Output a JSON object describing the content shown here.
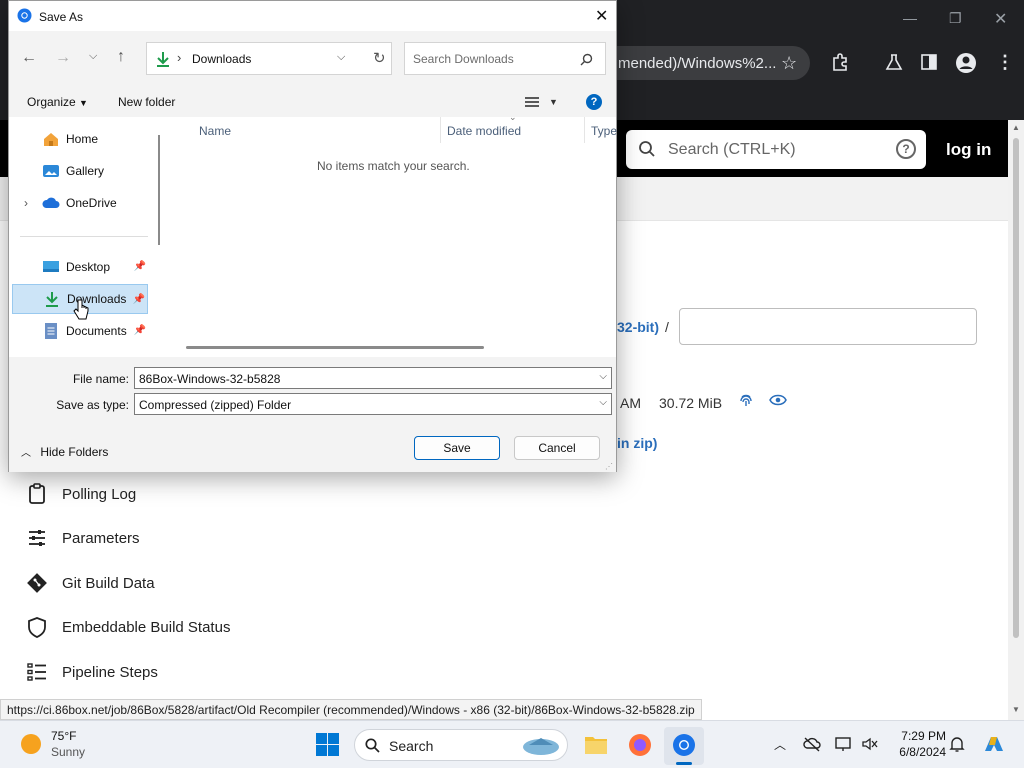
{
  "browser": {
    "address_fragment": "mended)/Windows%2...",
    "window_controls": [
      "minimize",
      "restore",
      "close"
    ]
  },
  "page": {
    "search_placeholder": "Search (CTRL+K)",
    "login_label": "log in",
    "frag_32bit": "32-bit)",
    "frag_slash": "/",
    "frag_am": "AM",
    "frag_size": "30.72 MiB",
    "frag_inzip": "in zip)",
    "sidebar": [
      {
        "label": "Polling Log",
        "icon": "clipboard-icon"
      },
      {
        "label": "Parameters",
        "icon": "sliders-icon"
      },
      {
        "label": "Git Build Data",
        "icon": "git-icon"
      },
      {
        "label": "Embeddable Build Status",
        "icon": "shield-icon"
      },
      {
        "label": "Pipeline Steps",
        "icon": "list-icon"
      }
    ],
    "status_url": "https://ci.86box.net/job/86Box/5828/artifact/Old Recompiler (recommended)/Windows - x86 (32-bit)/86Box-Windows-32-b5828.zip"
  },
  "dialog": {
    "title": "Save As",
    "path_label": "Downloads",
    "search_placeholder": "Search Downloads",
    "organize_label": "Organize",
    "new_folder_label": "New folder",
    "nav_items": [
      {
        "label": "Home",
        "icon": "home-icon",
        "pinned": false
      },
      {
        "label": "Gallery",
        "icon": "gallery-icon",
        "pinned": false
      },
      {
        "label": "OneDrive",
        "icon": "cloud-icon",
        "pinned": false
      },
      {
        "label": "Desktop",
        "icon": "desktop-icon",
        "pinned": true
      },
      {
        "label": "Downloads",
        "icon": "download-icon",
        "pinned": true,
        "selected": true
      },
      {
        "label": "Documents",
        "icon": "document-icon",
        "pinned": true
      }
    ],
    "columns": [
      "Name",
      "Date modified",
      "Type"
    ],
    "empty_message": "No items match your search.",
    "file_name_label": "File name:",
    "file_name_value": "86Box-Windows-32-b5828",
    "save_type_label": "Save as type:",
    "save_type_value": "Compressed (zipped) Folder",
    "hide_folders_label": "Hide Folders",
    "save_label": "Save",
    "cancel_label": "Cancel"
  },
  "taskbar": {
    "weather_temp": "75°F",
    "weather_desc": "Sunny",
    "search_label": "Search",
    "time": "7:29 PM",
    "date": "6/8/2024"
  },
  "colors": {
    "accent": "#0067c0",
    "link_blue": "#2a6ebb",
    "chrome_dark": "#202124"
  }
}
